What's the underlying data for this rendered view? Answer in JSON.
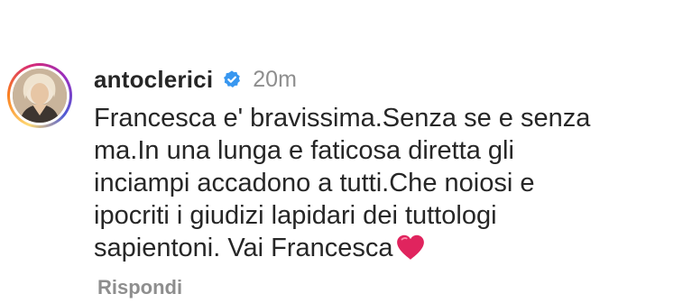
{
  "comment": {
    "username": "antoclerici",
    "time": "20m",
    "lines": [
      "Francesca e' bravissima.Senza se e senza",
      "ma.In una lunga e faticosa diretta gli",
      "inciampi accadono a tutti.Che noiosi e",
      "ipocriti i giudizi lapidari dei tuttologi",
      "sapientoni. Vai Francesca"
    ],
    "emoji": "heart-icon",
    "reply_label": "Rispondi"
  },
  "colors": {
    "verified": "#3897f0",
    "heart": "#e0245e",
    "muted": "#8e8e8e",
    "text": "#262626"
  }
}
